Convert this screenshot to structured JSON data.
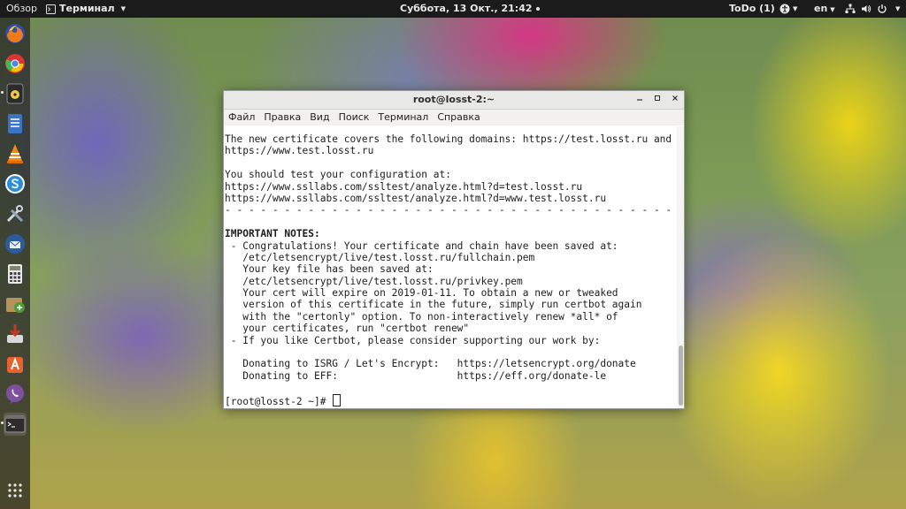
{
  "topbar": {
    "activities": "Обзор",
    "app_menu": "Терминал",
    "clock": "Суббота, 13 Окт., 21:42",
    "todo": "ToDo (1)",
    "lang": "en"
  },
  "window": {
    "title": "root@losst-2:~",
    "menu": [
      "Файл",
      "Правка",
      "Вид",
      "Поиск",
      "Терминал",
      "Справка"
    ]
  },
  "terminal": {
    "lines": [
      "The new certificate covers the following domains: https://test.losst.ru and",
      "https://www.test.losst.ru",
      "",
      "You should test your configuration at:",
      "https://www.ssllabs.com/ssltest/analyze.html?d=test.losst.ru",
      "https://www.ssllabs.com/ssltest/analyze.html?d=www.test.losst.ru",
      "- - - - - - - - - - - - - - - - - - - - - - - - - - - - - - - - - - - - - - - -",
      "",
      "IMPORTANT NOTES:",
      " - Congratulations! Your certificate and chain have been saved at:",
      "   /etc/letsencrypt/live/test.losst.ru/fullchain.pem",
      "   Your key file has been saved at:",
      "   /etc/letsencrypt/live/test.losst.ru/privkey.pem",
      "   Your cert will expire on 2019-01-11. To obtain a new or tweaked",
      "   version of this certificate in the future, simply run certbot again",
      "   with the \"certonly\" option. To non-interactively renew *all* of",
      "   your certificates, run \"certbot renew\"",
      " - If you like Certbot, please consider supporting our work by:",
      "",
      "   Donating to ISRG / Let's Encrypt:   https://letsencrypt.org/donate",
      "   Donating to EFF:                    https://eff.org/donate-le",
      ""
    ],
    "prompt": "[root@losst-2 ~]# "
  },
  "dock": {
    "icons": [
      "firefox-icon",
      "chrome-icon",
      "rhythmbox-icon",
      "files-icon",
      "vlc-icon",
      "skype-icon",
      "tools-icon",
      "thunderbird-icon",
      "calculator-icon",
      "archive-icon",
      "installer-icon",
      "software-icon",
      "viber-icon",
      "terminal-icon"
    ]
  },
  "colors": {
    "topbar": "#1b1b1b",
    "window_bg": "#ffffff",
    "titlebar": "#e8e8e7"
  }
}
